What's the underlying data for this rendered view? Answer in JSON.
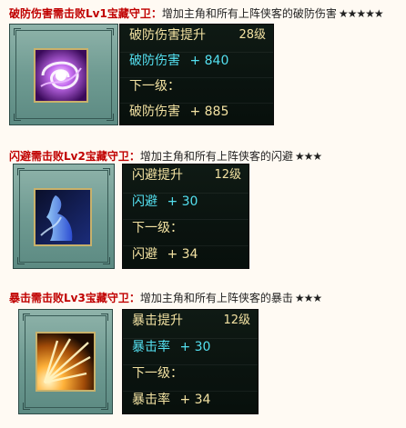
{
  "skills": [
    {
      "requirement": "破防伤害需击败Lv1宝藏守卫：",
      "description": "增加主角和所有上阵侠客的破防伤害",
      "stars": "★★★★★",
      "title": "破防伤害提升",
      "level": "28级",
      "current_stat": "破防伤害",
      "current_value": "+ 840",
      "next_label": "下一级：",
      "next_stat": "破防伤害",
      "next_value": "+ 885",
      "icon": "armor-break-swirl-icon"
    },
    {
      "requirement": "闪避需击败Lv2宝藏守卫：",
      "description": "增加主角和所有上阵侠客的闪避",
      "stars": "★★★",
      "title": "闪避提升",
      "level": "12级",
      "current_stat": "闪避",
      "current_value": "+ 30",
      "next_label": "下一级：",
      "next_stat": "闪避",
      "next_value": "+ 34",
      "icon": "dodge-silhouette-icon"
    },
    {
      "requirement": "暴击需击败Lv3宝藏守卫：",
      "description": "增加主角和所有上阵侠客的暴击",
      "stars": "★★★",
      "title": "暴击提升",
      "level": "12级",
      "current_stat": "暴击率",
      "current_value": "+ 30",
      "next_label": "下一级：",
      "next_stat": "暴击率",
      "next_value": "+ 34",
      "icon": "critical-burst-icon"
    }
  ],
  "colors": {
    "requirement_red": "#c00000",
    "gold_text": "#f3e2a2",
    "cyan_text": "#54e0f0",
    "frame_green": "#6f9b92"
  }
}
